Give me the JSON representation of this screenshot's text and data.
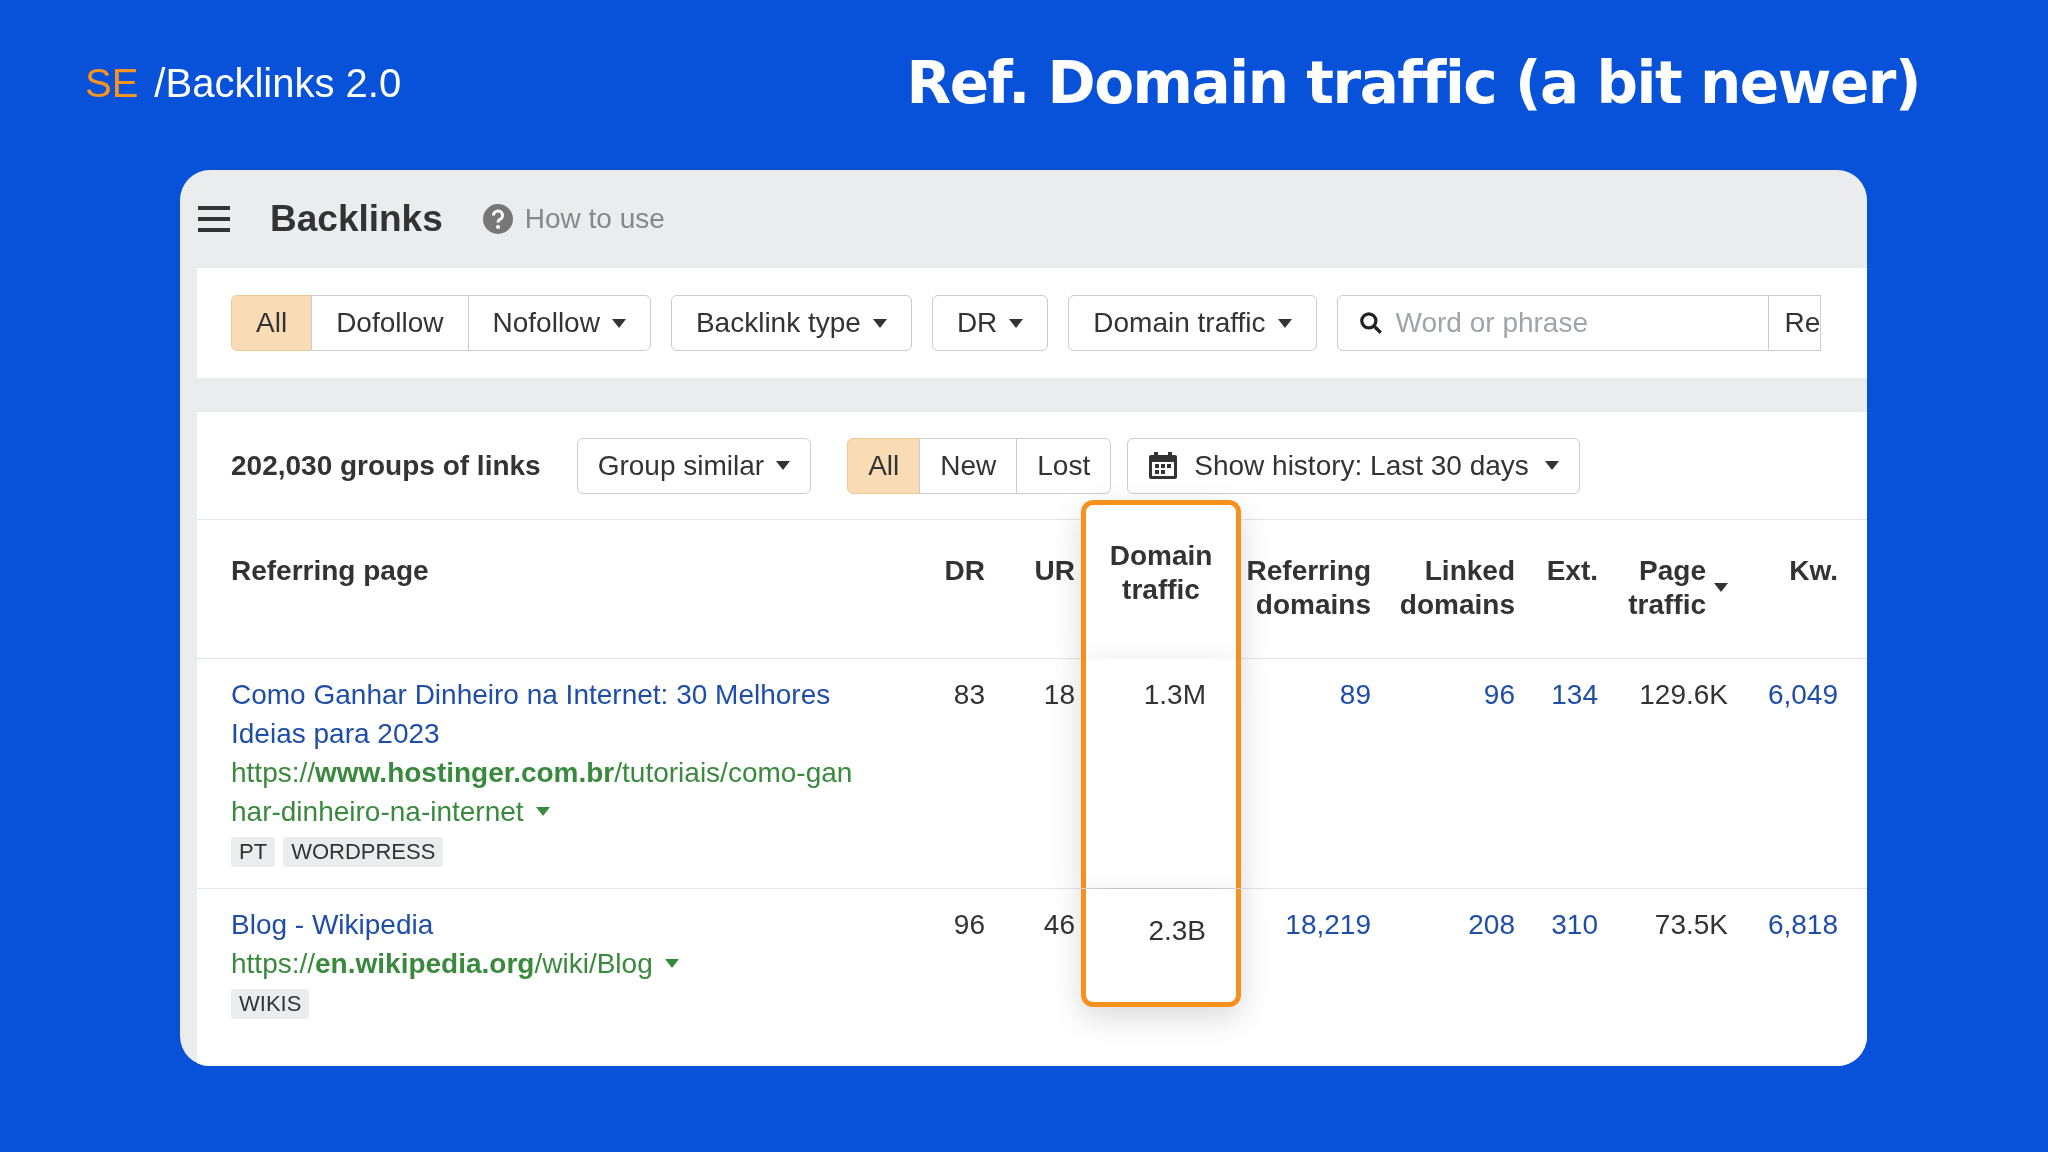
{
  "slide": {
    "brand": "SE",
    "product": "/Backlinks 2.0",
    "title": "Ref. Domain traffic (a bit newer)"
  },
  "header": {
    "title": "Backlinks",
    "help": "How to use"
  },
  "filters": [
    {
      "kind": "segment",
      "label": "All",
      "selected": true
    },
    {
      "kind": "segment",
      "label": "Dofollow",
      "selected": false
    },
    {
      "kind": "segment-dropdown",
      "label": "Nofollow",
      "selected": false
    },
    {
      "kind": "dropdown",
      "label": "Backlink type"
    },
    {
      "kind": "dropdown",
      "label": "DR"
    },
    {
      "kind": "dropdown",
      "label": "Domain traffic"
    },
    {
      "kind": "search",
      "placeholder": "Word or phrase"
    },
    {
      "kind": "cut",
      "label": "Re"
    }
  ],
  "summary": {
    "count": "202,030 groups of links",
    "group": "Group similar",
    "tabs": [
      {
        "label": "All",
        "selected": true
      },
      {
        "label": "New",
        "selected": false
      },
      {
        "label": "Lost",
        "selected": false
      }
    ],
    "history": "Show history: Last 30 days"
  },
  "table": {
    "columns": [
      {
        "label": "Referring page",
        "highlighted": false,
        "sorted": false
      },
      {
        "label": "DR",
        "highlighted": false,
        "sorted": false
      },
      {
        "label": "UR",
        "highlighted": false,
        "sorted": false
      },
      {
        "label": "Domain traffic",
        "highlighted": true,
        "sorted": false
      },
      {
        "label": "Referring domains",
        "highlighted": false,
        "sorted": false
      },
      {
        "label": "Linked domains",
        "highlighted": false,
        "sorted": false
      },
      {
        "label": "Ext.",
        "highlighted": false,
        "sorted": false
      },
      {
        "label": "Page traffic",
        "highlighted": false,
        "sorted": true
      },
      {
        "label": "Kw.",
        "highlighted": false,
        "sorted": false
      }
    ],
    "rows": [
      {
        "title": "Como Ganhar Dinheiro na Internet: 30 Melhores Ideias para 2023",
        "url_lines": [
          "https://**www.hostinger.com.br**/tutoriais/como-gan",
          "har-dinheiro-na-internet"
        ],
        "tags": [
          "PT",
          "WORDPRESS"
        ],
        "dr": "83",
        "ur": "18",
        "domain_traffic": "1.3M",
        "referring_domains": "89",
        "linked_domains": "96",
        "ext": "134",
        "page_traffic": "129.6K",
        "kw": "6,049"
      },
      {
        "title": "Blog - Wikipedia",
        "url_lines": [
          "https://**en.wikipedia.org**/wiki/Blog"
        ],
        "tags": [
          "WIKIS"
        ],
        "dr": "96",
        "ur": "46",
        "domain_traffic": "2.3B",
        "referring_domains": "18,219",
        "linked_domains": "208",
        "ext": "310",
        "page_traffic": "73.5K",
        "kw": "6,818"
      }
    ]
  }
}
